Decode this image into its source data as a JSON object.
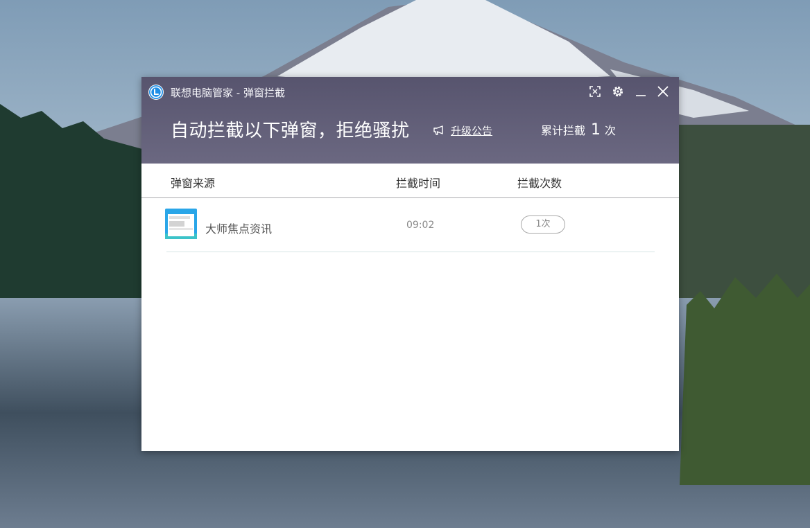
{
  "window": {
    "title": "联想电脑管家 - 弹窗拦截",
    "controls": {
      "fullscreen_icon": "expand-icon",
      "settings_icon": "gear-icon",
      "minimize_icon": "minimize-icon",
      "close_icon": "close-icon"
    }
  },
  "header": {
    "headline": "自动拦截以下弹窗，拒绝骚扰",
    "announcement_link": "升级公告",
    "counter_label": "累计拦截",
    "counter_value": "1",
    "counter_unit": "次"
  },
  "table": {
    "columns": [
      "弹窗来源",
      "拦截时间",
      "拦截次数"
    ],
    "rows": [
      {
        "source": "大师焦点资讯",
        "time": "09:02",
        "count": "1次",
        "icon": "app-window-icon"
      }
    ]
  },
  "colors": {
    "header_bg": "#5e5b74",
    "accent_logo": "#1e8ee6",
    "row_divider": "#d6e4e4"
  }
}
